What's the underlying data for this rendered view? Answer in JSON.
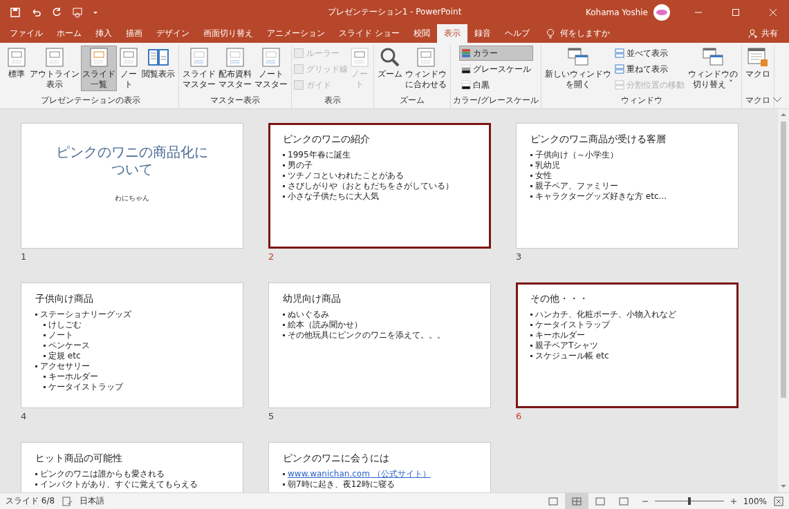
{
  "window": {
    "title": "プレゼンテーション1  -  PowerPoint",
    "user": "Kohama Yoshie"
  },
  "tabs": [
    {
      "label": "ファイル",
      "selected": false
    },
    {
      "label": "ホーム",
      "selected": false
    },
    {
      "label": "挿入",
      "selected": false
    },
    {
      "label": "描画",
      "selected": false
    },
    {
      "label": "デザイン",
      "selected": false
    },
    {
      "label": "画面切り替え",
      "selected": false
    },
    {
      "label": "アニメーション",
      "selected": false
    },
    {
      "label": "スライド ショー",
      "selected": false
    },
    {
      "label": "校閲",
      "selected": false
    },
    {
      "label": "表示",
      "selected": true
    },
    {
      "label": "録音",
      "selected": false
    },
    {
      "label": "ヘルプ",
      "selected": false
    }
  ],
  "tell_me": "何をしますか",
  "share": "共有",
  "ribbon": [
    {
      "label": "プレゼンテーションの表示",
      "items": [
        {
          "kind": "large",
          "label": [
            "標準"
          ],
          "selected": false,
          "disabled": false
        },
        {
          "kind": "large",
          "label": [
            "アウトライン",
            "表示"
          ],
          "selected": false,
          "disabled": false
        },
        {
          "kind": "large",
          "label": [
            "スライド",
            "一覧"
          ],
          "selected": true,
          "disabled": false
        },
        {
          "kind": "large",
          "label": [
            "ノー",
            "ト"
          ],
          "selected": false,
          "disabled": false
        },
        {
          "kind": "large",
          "label": [
            "閲覧表示"
          ],
          "selected": false,
          "disabled": false
        }
      ]
    },
    {
      "label": "マスター表示",
      "items": [
        {
          "kind": "large",
          "label": [
            "スライド",
            "マスター"
          ],
          "selected": false,
          "disabled": false
        },
        {
          "kind": "large",
          "label": [
            "配布資料",
            "マスター"
          ],
          "selected": false,
          "disabled": false
        },
        {
          "kind": "large",
          "label": [
            "ノート",
            "マスター"
          ],
          "selected": false,
          "disabled": false
        }
      ]
    },
    {
      "label": "表示",
      "items": [
        {
          "kind": "check",
          "label": "ルーラー",
          "checked": false,
          "disabled": true
        },
        {
          "kind": "check",
          "label": "グリッド線",
          "checked": false,
          "disabled": true
        },
        {
          "kind": "check",
          "label": "ガイド",
          "checked": false,
          "disabled": true
        },
        {
          "kind": "large",
          "label": [
            "ノー",
            "ト"
          ],
          "selected": false,
          "disabled": true
        }
      ]
    },
    {
      "label": "ズーム",
      "items": [
        {
          "kind": "large",
          "label": [
            "ズーム"
          ],
          "selected": false,
          "disabled": false
        },
        {
          "kind": "large",
          "label": [
            "ウィンドウ",
            "に合わせる"
          ],
          "selected": false,
          "disabled": false
        }
      ]
    },
    {
      "label": "カラー/グレースケール",
      "items": [
        {
          "kind": "small",
          "label": "カラー",
          "selected": true,
          "disabled": false
        },
        {
          "kind": "small",
          "label": "グレースケール",
          "selected": false,
          "disabled": false
        },
        {
          "kind": "small",
          "label": "白黒",
          "selected": false,
          "disabled": false
        }
      ]
    },
    {
      "label": "ウィンドウ",
      "items": [
        {
          "kind": "large",
          "label": [
            "新しいウィンドウ",
            "を開く"
          ],
          "selected": false,
          "disabled": false
        },
        {
          "kind": "small",
          "label": "並べて表示",
          "selected": false,
          "disabled": false
        },
        {
          "kind": "small",
          "label": "重ねて表示",
          "selected": false,
          "disabled": false
        },
        {
          "kind": "small",
          "label": "分割位置の移動",
          "selected": false,
          "disabled": true
        },
        {
          "kind": "large",
          "label": [
            "ウィンドウの",
            "切り替え ˇ"
          ],
          "selected": false,
          "disabled": false
        }
      ]
    },
    {
      "label": "マクロ",
      "items": [
        {
          "kind": "large",
          "label": [
            "マクロ"
          ],
          "selected": false,
          "disabled": false
        }
      ]
    }
  ],
  "slides": [
    {
      "number": "1",
      "selected": false,
      "kind": "title",
      "title": [
        "ピンクのワニの商品化に",
        "ついて"
      ],
      "subtitle": "わにちゃん"
    },
    {
      "number": "2",
      "selected": true,
      "kind": "content",
      "title": "ピンクのワニの紹介",
      "bullets": [
        {
          "text": "1995年春に誕生"
        },
        {
          "text": "男の子"
        },
        {
          "text": "ツチノコといわれたことがある"
        },
        {
          "text": "さびしがりや（おともだちをさがしている）"
        },
        {
          "text": "小さな子供たちに大人気"
        }
      ]
    },
    {
      "number": "3",
      "selected": false,
      "kind": "content",
      "title": "ピンクのワニ商品が受ける客層",
      "bullets": [
        {
          "text": "子供向け（～小学生）"
        },
        {
          "text": "乳幼児"
        },
        {
          "text": "女性"
        },
        {
          "text": "親子ペア、ファミリー"
        },
        {
          "text": "キャラクターグッズ好きな方 etc..."
        }
      ]
    },
    {
      "number": "4",
      "selected": false,
      "kind": "content",
      "title": "子供向け商品",
      "bullets": [
        {
          "text": "ステーショナリーグッズ",
          "children": [
            {
              "text": "けしごむ"
            },
            {
              "text": "ノート"
            },
            {
              "text": "ペンケース"
            },
            {
              "text": "定規 etc"
            }
          ]
        },
        {
          "text": "アクセサリー",
          "children": [
            {
              "text": "キーホルダー"
            },
            {
              "text": "ケータイストラップ"
            }
          ]
        }
      ]
    },
    {
      "number": "5",
      "selected": false,
      "kind": "content",
      "title": "幼児向け商品",
      "bullets": [
        {
          "text": "ぬいぐるみ"
        },
        {
          "text": "絵本（読み聞かせ）"
        },
        {
          "text": "その他玩具にピンクのワニを添えて。。。"
        }
      ]
    },
    {
      "number": "6",
      "selected": true,
      "kind": "content",
      "title": "その他・・・",
      "bullets": [
        {
          "text": "ハンカチ、化粧ポーチ、小物入れなど"
        },
        {
          "text": "ケータイストラップ"
        },
        {
          "text": "キーホルダー"
        },
        {
          "text": "親子ペアTシャツ"
        },
        {
          "text": "スケジュール帳 etc"
        }
      ]
    },
    {
      "selected": false,
      "kind": "content",
      "title": "ヒット商品の可能性",
      "bullets": [
        {
          "text": "ピンクのワニは誰からも愛される"
        },
        {
          "text": "インパクトがあり、すぐに覚えてもらえる"
        }
      ]
    },
    {
      "selected": false,
      "kind": "content",
      "title": "ピンクのワニに会うには",
      "bullets": [
        {
          "text": "www.wanichan.com （公式サイト）",
          "kind": "link"
        },
        {
          "text": "朝7時に起き、夜12時に寝る"
        }
      ]
    }
  ],
  "status": {
    "slide_info": "スライド 6/8",
    "language": "日本語",
    "views": [
      {
        "selected": false
      },
      {
        "selected": true
      },
      {
        "selected": false
      },
      {
        "selected": false
      }
    ],
    "zoom": {
      "level": 0.5
    },
    "zoom_text": "100%"
  }
}
